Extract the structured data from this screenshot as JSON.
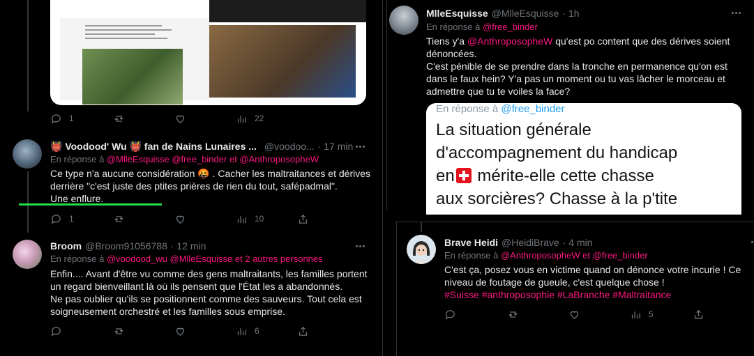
{
  "left_panel": {
    "top_tweet_actions": {
      "reply_count": "1",
      "retweet_count": "",
      "like_count": "",
      "views_count": "22"
    },
    "tweets": [
      {
        "name": "👹 Voodood' Wu 👹 fan de Nains Lunaires ...",
        "handle": "@voodoo...",
        "time": "· 17 min",
        "reply_prefix": "En réponse à",
        "reply_mentions": "@MlleEsquisse @free_binder  et  @AnthroposopheW",
        "body_line1": "Ce type n'a aucune considération 🤬 . Cacher les maltraitances et dérives",
        "body_line2": "derrière \"c'est juste des ptites prières de rien du tout, safépadmal\".",
        "body_line3": "Une enflure.",
        "reply_count": "1",
        "retweet_count": "",
        "like_count": "",
        "views_count": "10"
      },
      {
        "name": "Broom",
        "handle": "@Broom91056788",
        "time": "· 12 min",
        "reply_prefix": "En réponse à",
        "reply_mentions": "@voodood_wu @MlleEsquisse  et 2 autres personnes",
        "body_line1": "Enfin.... Avant d'être vu comme des gens maltraitants, les familles portent",
        "body_line2": "un regard bienveillant là où ils pensent que l'État les a abandonnés.",
        "body_line3": "Ne pas oublier qu'ils se positionnent comme des sauveurs. Tout cela est",
        "body_line4": "soigneusement orchestré et les familles sous emprise.",
        "views_count": "6"
      }
    ]
  },
  "right_top": {
    "name": "MlleEsquisse",
    "handle": "@MlleEsquisse",
    "time": "· 1h",
    "reply_prefix": "En réponse à",
    "reply_mentions": "@free_binder",
    "body_line1_pre": "Tiens y'a ",
    "body_line1_mention": "@AnthroposopheW",
    "body_line1_post": " qu'est po content que des dérives soient",
    "body_line2": "dénoncées.",
    "body_line3": "C'est pénible de se prendre dans la tronche en permanence qu'on est",
    "body_line4": "dans le faux hein? Y'a pas un moment ou tu vas lâcher le morceau et",
    "body_line5": "admettre que tu te voiles la face?",
    "quote": {
      "reply_prefix": "En réponse à",
      "reply_mention": "@free_binder",
      "line1": "La situation générale",
      "line2": "d'accompagnement du handicap",
      "line3_pre": "en",
      "line3_post": " mérite-elle cette chasse",
      "line4": "aux sorcières? Chasse à la p'tite"
    }
  },
  "right_bottom": {
    "name": "Brave Heidi",
    "handle": "@HeidiBrave",
    "time": "· 4 min",
    "reply_prefix": "En réponse à",
    "reply_mentions": "@AnthroposopheW  et  @free_binder",
    "body_line1": "C'est ça, posez vous en victime quand on dénonce votre incurie ! Ce",
    "body_line2": "niveau de foutage de gueule, c'est quelque chose !",
    "hashtags": "#Suisse #anthroposophie #LaBranche #Maltraitance",
    "views_count": "5"
  },
  "colors": {
    "background": "#000000",
    "text": "#e7e9ea",
    "muted": "#71767b",
    "accent_mention": "#f91880",
    "highlight_underline": "#22e04a"
  }
}
